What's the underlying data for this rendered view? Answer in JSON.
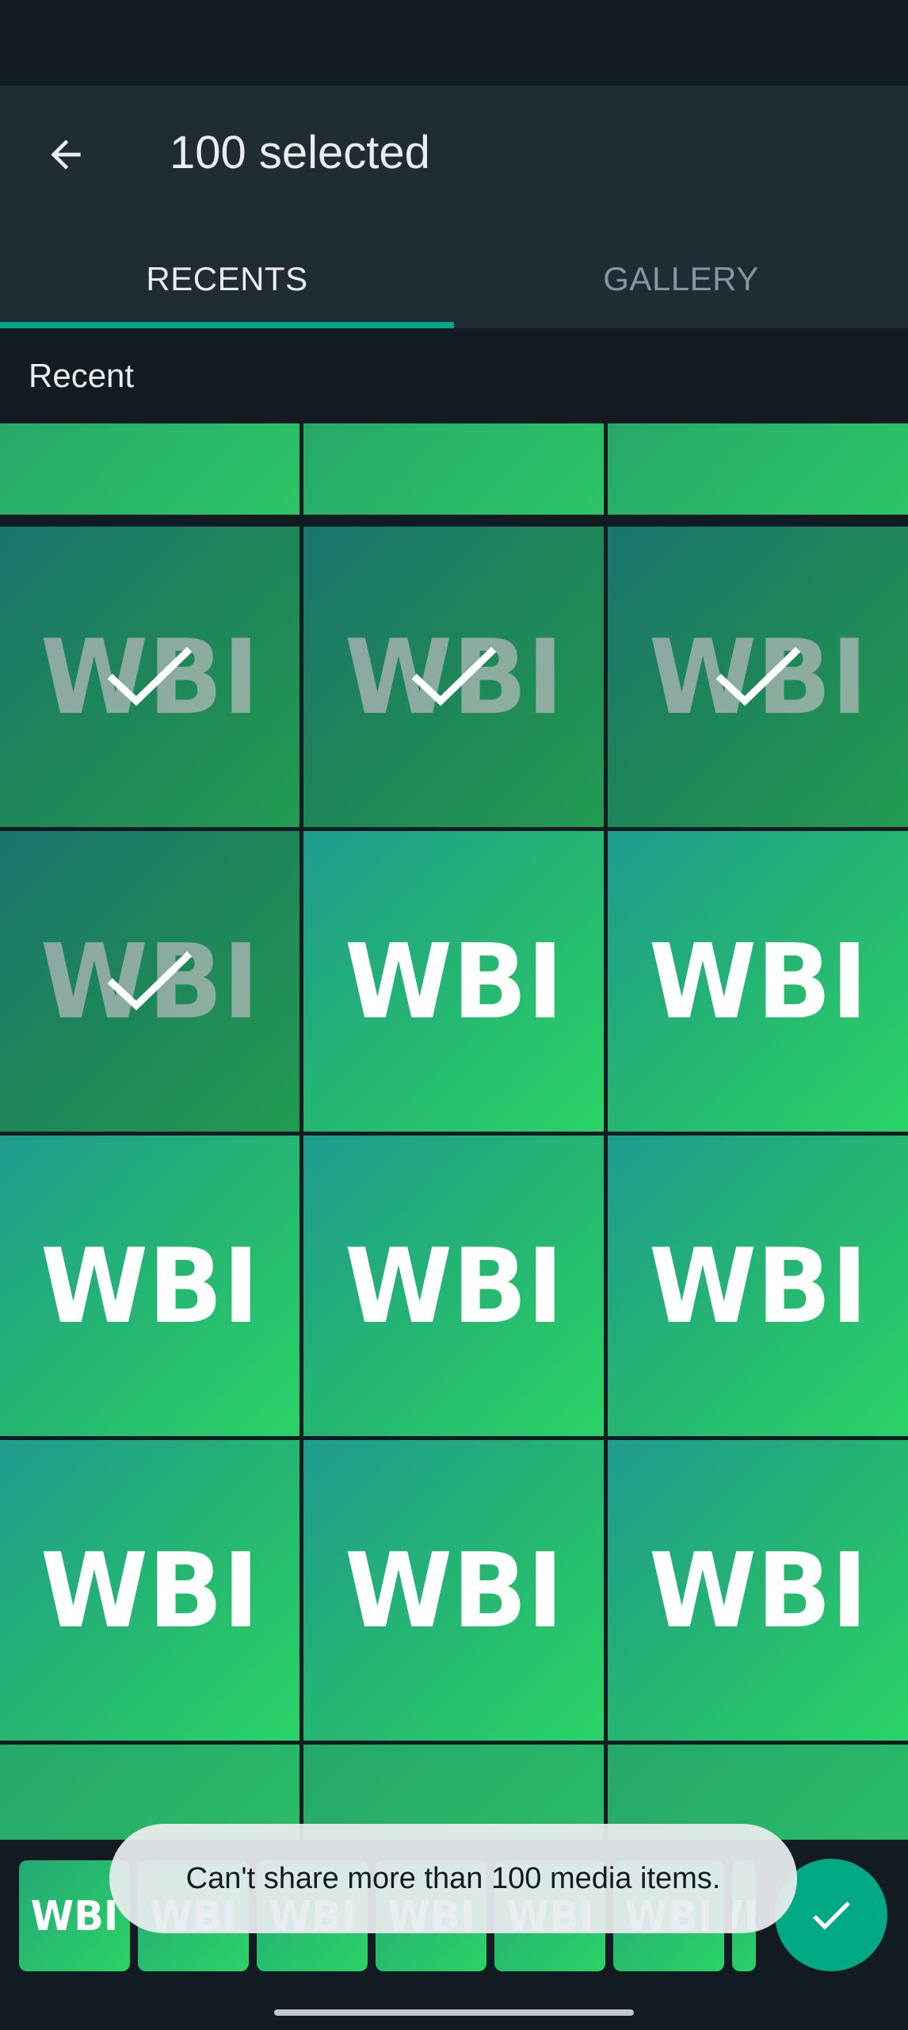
{
  "header": {
    "title": "100 selected"
  },
  "tabs": [
    {
      "label": "RECENTS",
      "active": true
    },
    {
      "label": "GALLERY",
      "active": false
    }
  ],
  "section": {
    "label": "Recent"
  },
  "grid": {
    "tile_logo_text": "WBI",
    "rows": [
      [
        {
          "selected": false,
          "partial": true
        },
        {
          "selected": false,
          "partial": true
        },
        {
          "selected": false,
          "partial": true
        }
      ],
      [
        {
          "selected": true
        },
        {
          "selected": true
        },
        {
          "selected": true
        }
      ],
      [
        {
          "selected": true
        },
        {
          "selected": false
        },
        {
          "selected": false
        }
      ],
      [
        {
          "selected": false
        },
        {
          "selected": false
        },
        {
          "selected": false
        }
      ],
      [
        {
          "selected": false
        },
        {
          "selected": false
        },
        {
          "selected": false
        }
      ],
      [
        {
          "selected": false,
          "partial": true
        },
        {
          "selected": false,
          "partial": true
        },
        {
          "selected": false,
          "partial": true
        }
      ]
    ]
  },
  "toast": {
    "message": "Can't share more than 100 media items."
  },
  "colors": {
    "accent": "#00a884",
    "app_bar": "#202c33",
    "background": "#111b21"
  },
  "icons": {
    "back": "arrow-left-icon",
    "send": "check-icon",
    "selected": "check-icon"
  }
}
